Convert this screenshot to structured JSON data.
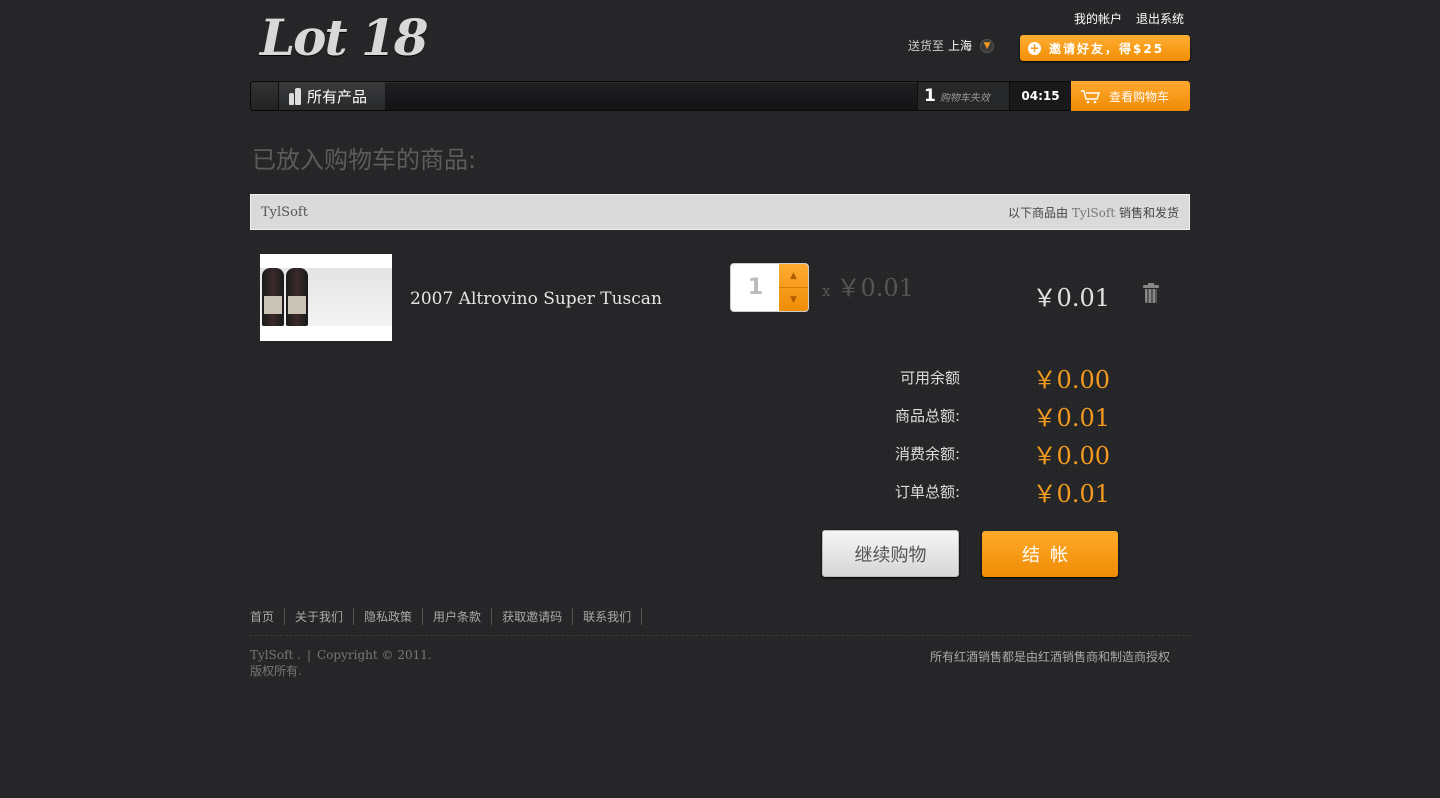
{
  "header": {
    "logo_text": "Lot 18",
    "top_links": [
      "我的帐户",
      "退出系统"
    ],
    "ship_to_label": "送货至",
    "ship_to_city": "上海",
    "invite_label": "邀请好友，得$25"
  },
  "nav": {
    "all_products": "所有产品",
    "cart_expire_count": "1",
    "cart_expire_label": "购物车失效",
    "timer": "04:15",
    "view_cart": "查看购物车"
  },
  "cart": {
    "heading": "已放入购物车的商品:",
    "seller_name": "TylSoft",
    "seller_note_prefix": "以下商品由",
    "seller_note_name": "TylSoft",
    "seller_note_suffix": "销售和发货",
    "items": [
      {
        "name": "2007 Altrovino Super Tuscan",
        "quantity": "1",
        "unit_prefix": "x",
        "unit_price": "￥0.01",
        "line_total": "￥0.01"
      }
    ],
    "totals": [
      {
        "label": "可用余额",
        "amount": "￥0.00"
      },
      {
        "label": "商品总额:",
        "amount": "￥0.01"
      },
      {
        "label": "消费余额:",
        "amount": "￥0.00"
      },
      {
        "label": "订单总额:",
        "amount": "￥0.01"
      }
    ],
    "continue_label": "继续购物",
    "checkout_label": "结帐"
  },
  "footer": {
    "links": [
      "首页",
      "关于我们",
      "隐私政策",
      "用户条款",
      "获取邀请码",
      "联系我们"
    ],
    "copyright_company": "TylSoft .",
    "copyright_text": "Copyright © 2011.",
    "rights": "版权所有.",
    "notice": "所有红酒销售都是由红酒销售商和制造商授权"
  },
  "colors": {
    "accent": "#f29b1f",
    "background": "#252628"
  }
}
